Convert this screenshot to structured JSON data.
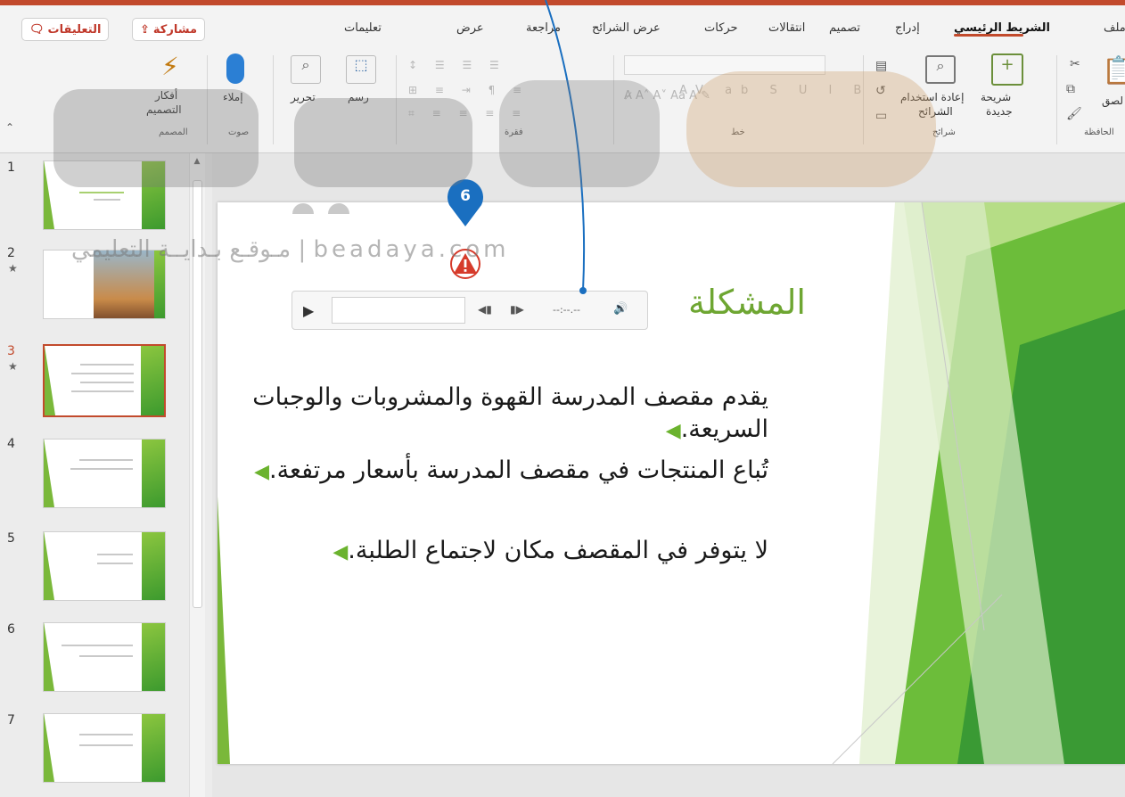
{
  "ribbon": {
    "tabs": [
      "ملف",
      "الشريط الرئيسي",
      "إدراج",
      "تصميم",
      "انتقالات",
      "حركات",
      "عرض الشرائح",
      "مراجعة",
      "عرض",
      "تعليمات"
    ],
    "share_label": "مشاركة",
    "comments_label": "التعليقات",
    "groups": {
      "clipboard": "الحافظة",
      "slides": "شرائح",
      "font": "خط",
      "paragraph": "فقرة",
      "voice": "صوت",
      "designer": "المصمم"
    },
    "buttons": {
      "paste": "لصق",
      "new_slide_line1": "شريحة",
      "new_slide_line2": "جديدة",
      "reuse_line1": "إعادة استخدام",
      "reuse_line2": "الشرائح",
      "draw": "رسم",
      "edit": "تحرير",
      "dictate": "إملاء",
      "design_ideas_line1": "أفكار",
      "design_ideas_line2": "التصميم"
    }
  },
  "thumbnails": [
    {
      "num": "1",
      "star": ""
    },
    {
      "num": "2",
      "star": "★"
    },
    {
      "num": "3",
      "star": "★"
    },
    {
      "num": "4",
      "star": ""
    },
    {
      "num": "5",
      "star": ""
    },
    {
      "num": "6",
      "star": ""
    },
    {
      "num": "7",
      "star": ""
    }
  ],
  "selected_slide": 3,
  "slide": {
    "title": "المشكلة",
    "bullets": [
      "يقدم مقصف المدرسة القهوة والمشروبات والوجبات السريعة.",
      "تُباع المنتجات في مقصف المدرسة بأسعار مرتفعة.",
      "لا يتوفر في المقصف مكان لاجتماع الطلبة."
    ]
  },
  "audio_player": {
    "time": "--:--.--"
  },
  "callout": {
    "number": "6"
  },
  "watermark": {
    "text": "مـوقـع بـدايــة التعليمي | beadaya.com"
  },
  "colors": {
    "accent": "#c24a2c",
    "green": "#6ea632",
    "callout": "#1a6fc0"
  }
}
